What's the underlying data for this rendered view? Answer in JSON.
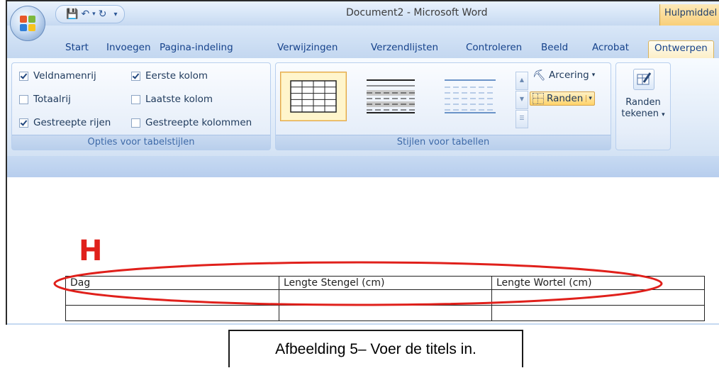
{
  "window": {
    "title": "Document2 - Microsoft Word",
    "context_tab_title": "Hulpmiddel"
  },
  "tabs": [
    {
      "label": "Start"
    },
    {
      "label": "Invoegen"
    },
    {
      "label": "Pagina-indeling"
    },
    {
      "label": "Verwijzingen"
    },
    {
      "label": "Verzendlijsten"
    },
    {
      "label": "Controleren"
    },
    {
      "label": "Beeld"
    },
    {
      "label": "Acrobat"
    },
    {
      "label": "Ontwerpen",
      "active": true
    }
  ],
  "ribbon": {
    "options_group": {
      "label": "Opties voor tabelstijlen",
      "checkboxes": [
        {
          "label": "Veldnamenrij",
          "checked": true
        },
        {
          "label": "Totaalrij",
          "checked": false
        },
        {
          "label": "Gestreepte rijen",
          "checked": true
        },
        {
          "label": "Eerste kolom",
          "checked": true
        },
        {
          "label": "Laatste kolom",
          "checked": false
        },
        {
          "label": "Gestreepte kolommen",
          "checked": false
        }
      ]
    },
    "styles_group": {
      "label": "Stijlen voor tabellen",
      "shading_label": "Arcering",
      "borders_label": "Randen"
    },
    "draw_group": {
      "label_line1": "Randen",
      "label_line2": "tekenen"
    }
  },
  "document": {
    "marker_letter": "H",
    "table": {
      "headers": [
        "Dag",
        "Lengte Stengel (cm)",
        "Lengte Wortel (cm)"
      ],
      "empty_rows": 3
    },
    "annotation_color": "#e0201b"
  },
  "caption": "Afbeelding 5– Voer de titels in."
}
